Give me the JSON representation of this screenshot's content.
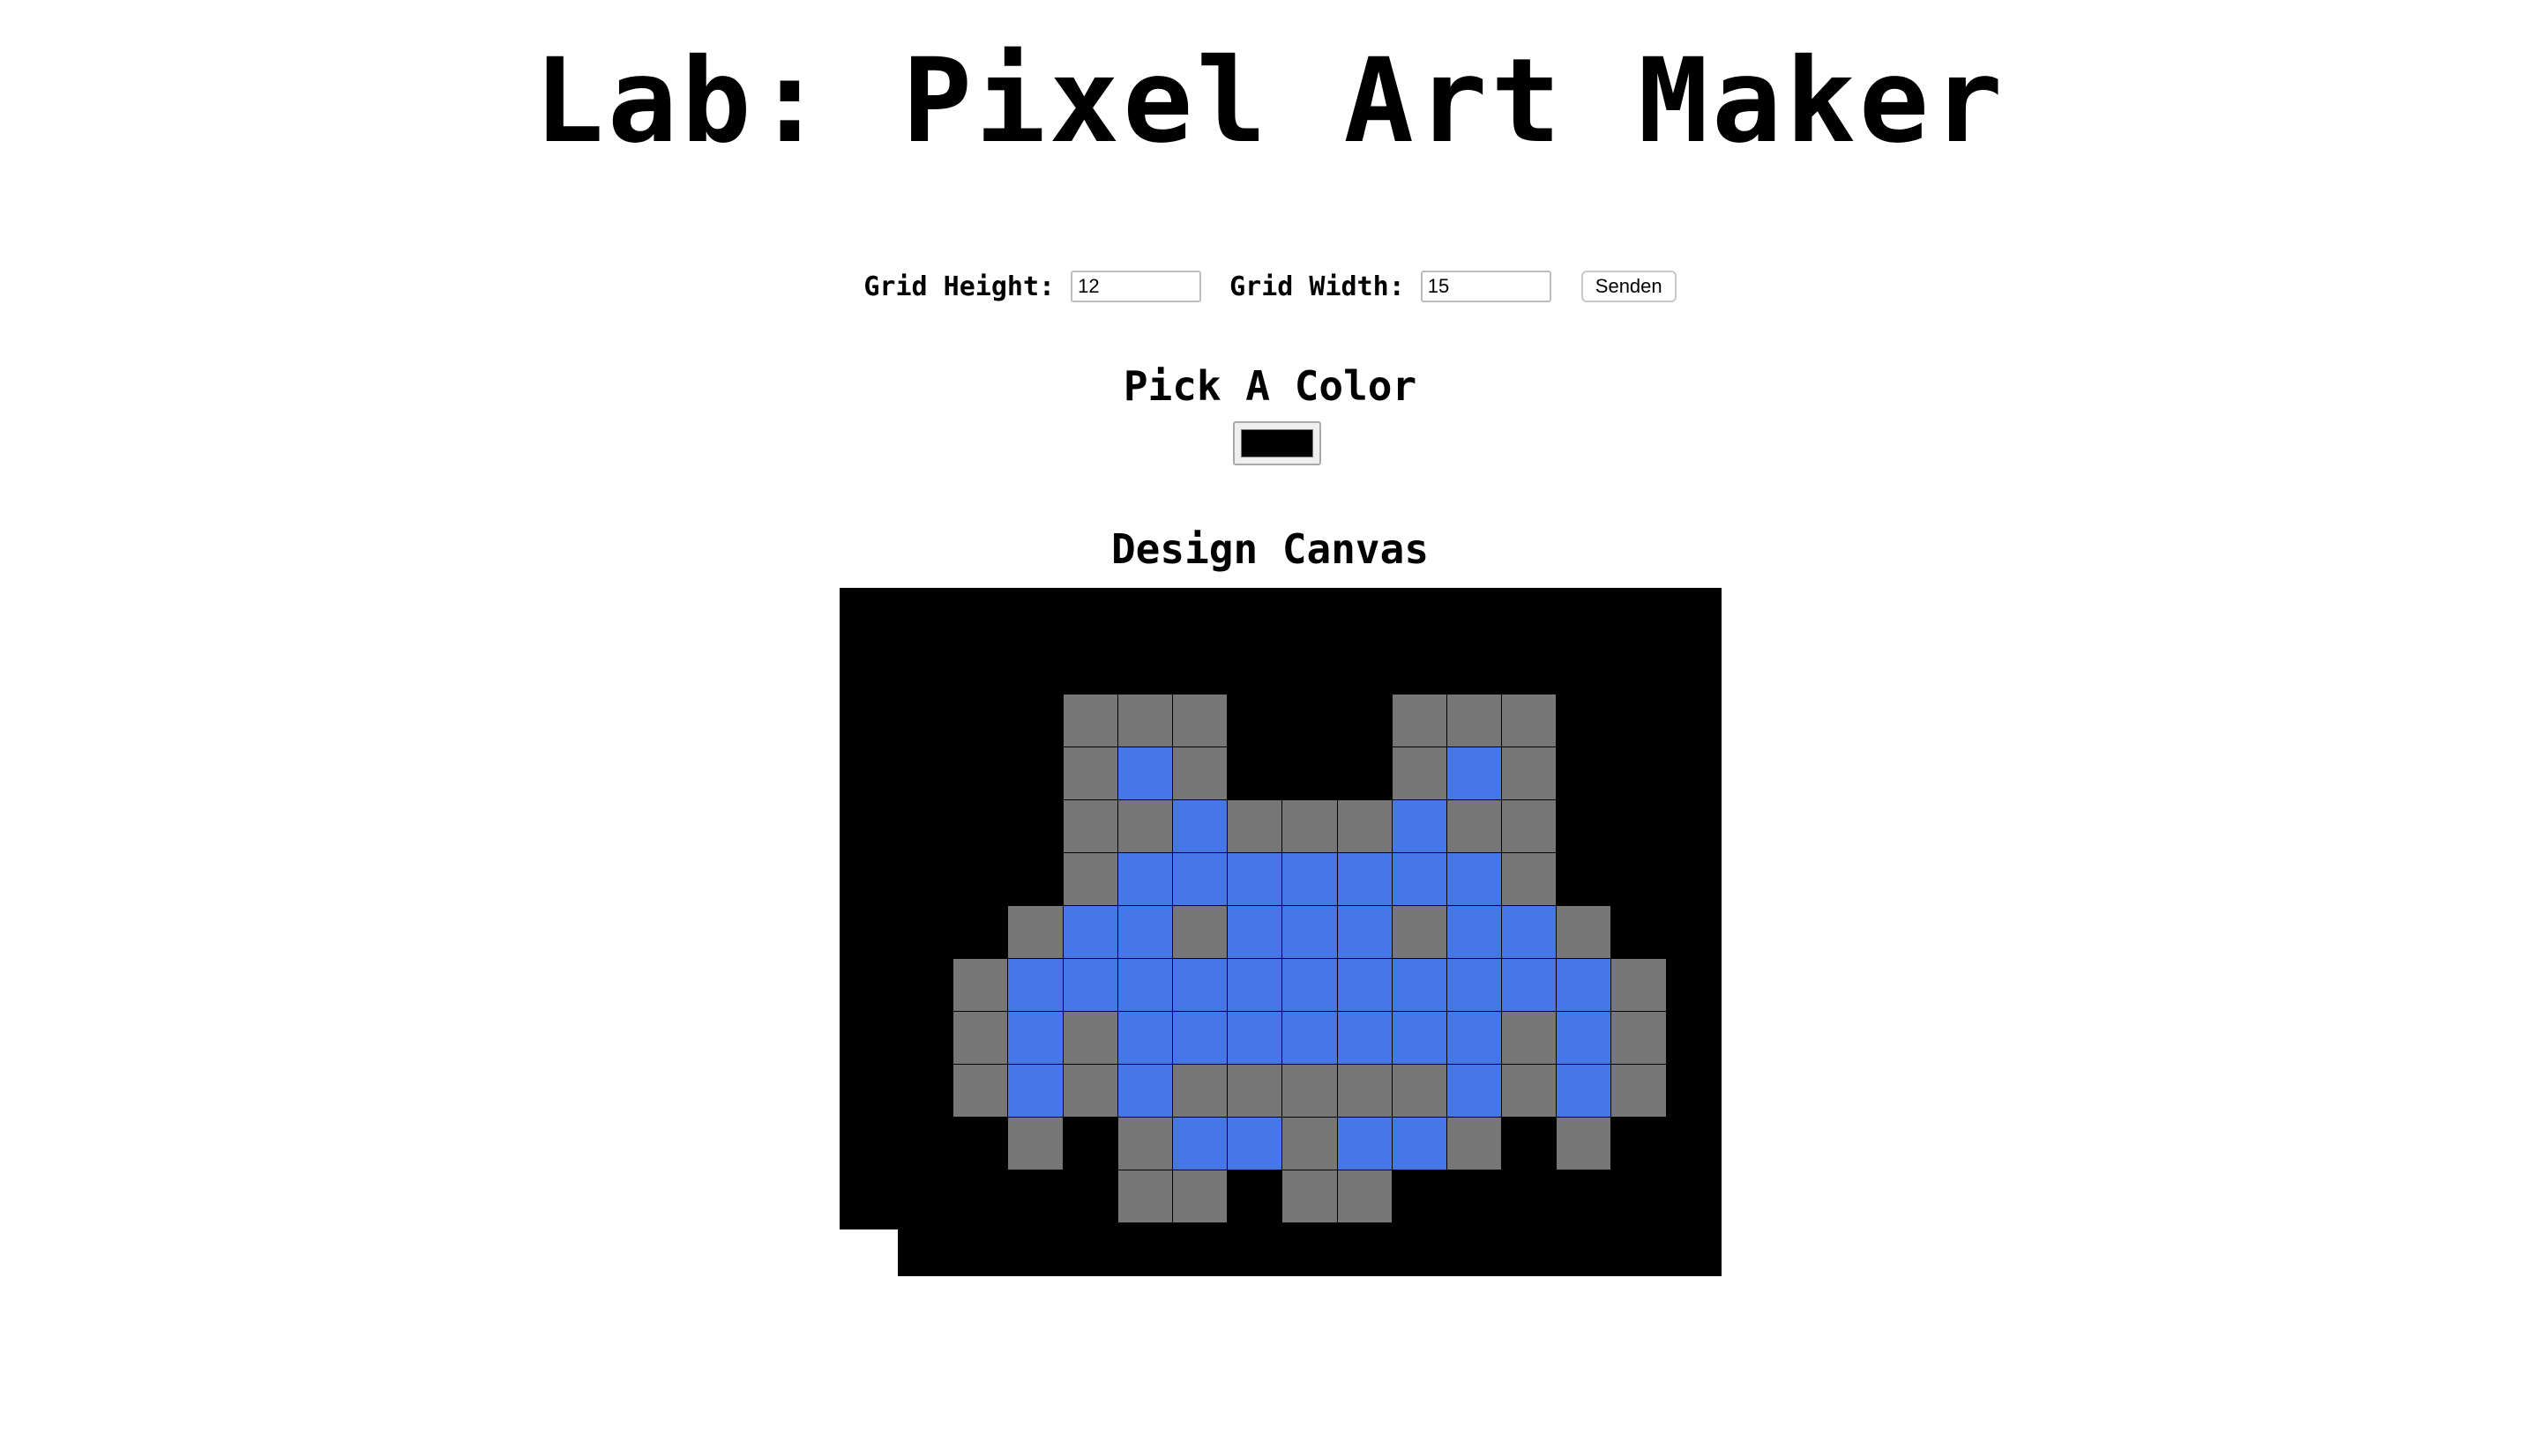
{
  "header": {
    "title": "Lab: Pixel Art Maker"
  },
  "size_form": {
    "height_label": "Grid Height:",
    "height_value": "12",
    "width_label": "Grid Width:",
    "width_value": "15",
    "submit_label": "Senden"
  },
  "color_picker": {
    "title": "Pick A Color",
    "value": "#000000"
  },
  "canvas": {
    "title": "Design Canvas",
    "rows": 12,
    "cols": 15,
    "palette": {
      "K": "#000000",
      "G": "#777777",
      "B": "#4677e6"
    },
    "pixels": [
      "KKKKKKKKKKKKKKK",
      "KKKGGGKKKGGGKKK",
      "KKKGBGKKKGBGKKK",
      "KKKGGBGGGBGGKKK",
      "KKKGBBBBBBBGKKK",
      "KKGBBGBBBGBBGKK",
      "KGBBBBBBBBBBBGK",
      "KGBGBBBBBBBGBGK",
      "KGBGBGGGGGBGBGK",
      "KKGKGBBGBBGKGKK",
      "KKKKGGKGGKKKKKK",
      "KKKKKKKKKKKKKKK"
    ]
  }
}
